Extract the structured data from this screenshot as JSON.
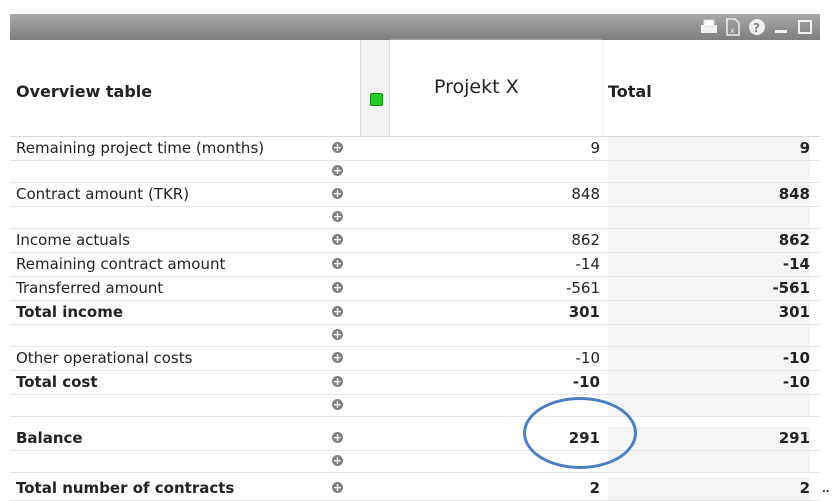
{
  "header": {
    "title": "Overview table",
    "project_col": "Projekt X",
    "total_col": "Total"
  },
  "toolbar": {
    "icons": [
      "print-icon",
      "excel-export-icon",
      "help-icon",
      "minimize-icon",
      "maximize-icon"
    ]
  },
  "rows": [
    {
      "label": "Remaining project time (months)",
      "project": "9",
      "total": "9",
      "bold": false
    },
    {
      "label": "",
      "project": "",
      "total": "",
      "bold": false
    },
    {
      "label": "Contract amount (TKR)",
      "project": "848",
      "total": "848",
      "bold": false
    },
    {
      "label": "",
      "project": "",
      "total": "",
      "bold": false
    },
    {
      "label": "Income actuals",
      "project": "862",
      "total": "862",
      "bold": false
    },
    {
      "label": "Remaining contract amount",
      "project": "-14",
      "total": "-14",
      "bold": false
    },
    {
      "label": "Transferred amount",
      "project": "-561",
      "total": "-561",
      "bold": false
    },
    {
      "label": "Total income",
      "project": "301",
      "total": "301",
      "bold": true
    },
    {
      "label": "",
      "project": "",
      "total": "",
      "bold": false
    },
    {
      "label": "Other operational costs",
      "project": "-10",
      "total": "-10",
      "bold": false
    },
    {
      "label": "Total cost",
      "project": "-10",
      "total": "-10",
      "bold": true
    },
    {
      "label": "",
      "project": "",
      "total": "",
      "bold": false
    },
    {
      "label": "Balance",
      "project": "291",
      "total": "291",
      "bold": true
    },
    {
      "label": "",
      "project": "",
      "total": "",
      "bold": false
    },
    {
      "label": "Total number of contracts",
      "project": "2",
      "total": "2",
      "bold": true
    }
  ],
  "colors": {
    "titlebar": "#8c8c8c",
    "highlight_ring": "#4a7ec5",
    "indicator": "#22cc22"
  }
}
